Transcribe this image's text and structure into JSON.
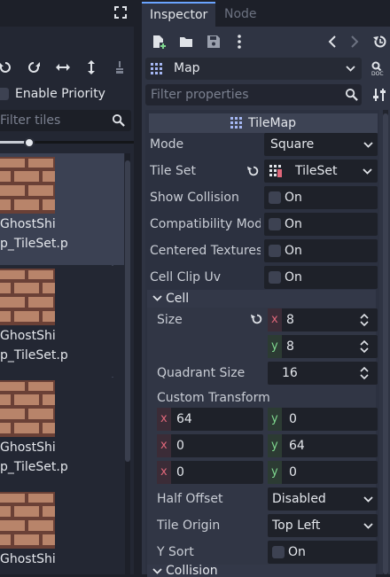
{
  "left_panel": {
    "enable_priority_label": "Enable Priority",
    "filter_placeholder": "Filter tiles",
    "tiles": [
      {
        "line1": "GhostShi",
        "line2": "p_TileSet.p",
        "selected": true
      },
      {
        "line1": "GhostShi",
        "line2": "p_TileSet.p",
        "selected": false
      },
      {
        "line1": "GhostShi",
        "line2": "p_TileSet.p",
        "selected": false
      },
      {
        "line1": "GhostShi",
        "line2": "",
        "selected": false
      }
    ]
  },
  "tabs": {
    "inspector": "Inspector",
    "node": "Node"
  },
  "inspector": {
    "object_name": "Map",
    "filter_placeholder": "Filter properties",
    "class_header": "TileMap",
    "props": {
      "mode_label": "Mode",
      "mode_value": "Square",
      "tileset_label": "Tile Set",
      "tileset_value": "TileSet",
      "show_collision_label": "Show Collision",
      "show_collision_value": "On",
      "compat_label": "Compatibility Mod",
      "compat_value": "On",
      "centered_label": "Centered Textures",
      "centered_value": "On",
      "clip_uv_label": "Cell Clip Uv",
      "clip_uv_value": "On"
    },
    "cell_section": {
      "title": "Cell",
      "size_label": "Size",
      "size_x_axis": "x",
      "size_x": "8",
      "size_y_axis": "y",
      "size_y": "8",
      "quadrant_label": "Quadrant Size",
      "quadrant_value": "16",
      "transform_label": "Custom Transform",
      "transform": [
        {
          "a_axis": "x",
          "a": "64",
          "b_axis": "y",
          "b": "0"
        },
        {
          "a_axis": "x",
          "a": "0",
          "b_axis": "y",
          "b": "64"
        },
        {
          "a_axis": "x",
          "a": "0",
          "b_axis": "y",
          "b": "0"
        }
      ],
      "half_offset_label": "Half Offset",
      "half_offset_value": "Disabled",
      "tile_origin_label": "Tile Origin",
      "tile_origin_value": "Top Left",
      "y_sort_label": "Y Sort",
      "y_sort_value": "On"
    },
    "collision_section": {
      "title": "Collision"
    }
  },
  "colors": {
    "accent": "#6aa4ff",
    "axis_x": "#e0677a",
    "axis_y": "#7fd88f",
    "tile_brick": "#b8846a",
    "tile_dark": "#6a4036"
  }
}
